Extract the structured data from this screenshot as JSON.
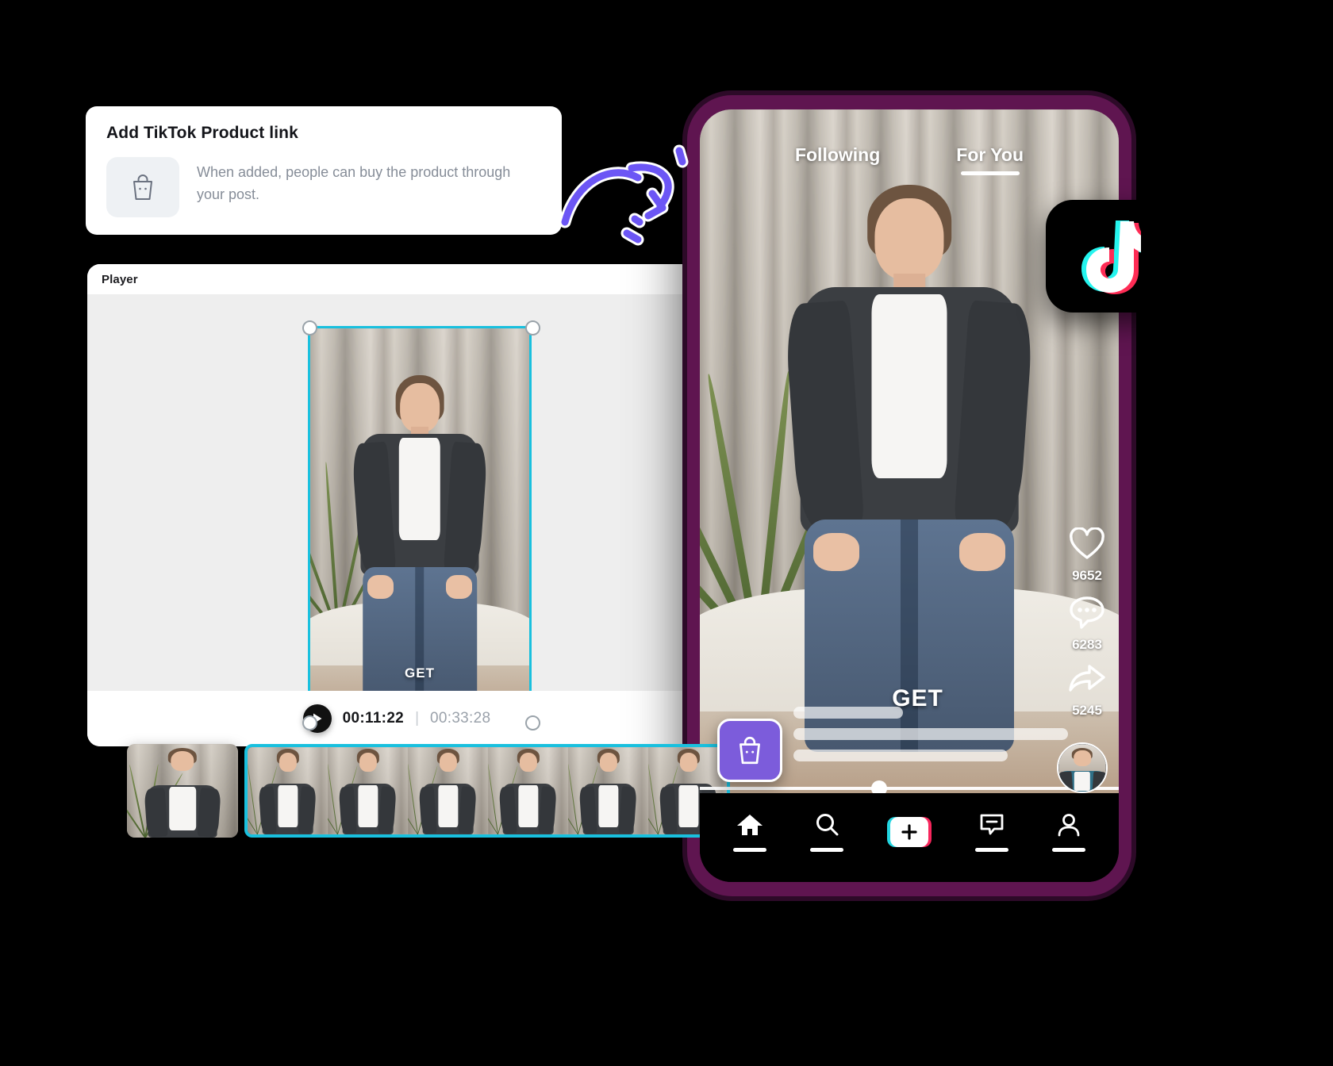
{
  "card": {
    "title": "Add TikTok Product link",
    "description": "When added, people can buy the product through your post.",
    "icon": "shopping-bag-icon"
  },
  "editor": {
    "title": "Player",
    "controls": {
      "play_icon": "play-icon",
      "current_time": "00:11:22",
      "separator": "|",
      "total_time": "00:33:28"
    },
    "selection_color": "#19c0de",
    "canvas_bg": "#eeeeee",
    "overlay_text": "GET"
  },
  "timeline": {
    "clip_count": 6,
    "selected_border_color": "#19c0de"
  },
  "phone": {
    "frame_color": "#5f1550",
    "tabs": [
      {
        "label": "Following",
        "active": false
      },
      {
        "label": "For You",
        "active": true
      }
    ],
    "rail": [
      {
        "icon": "heart-icon",
        "count": "9652"
      },
      {
        "icon": "comment-icon",
        "count": "6283"
      },
      {
        "icon": "share-icon",
        "count": "5245"
      }
    ],
    "shop_button": {
      "icon": "shopping-bag-icon",
      "color": "#7c5cdb"
    },
    "avatar": "avatar",
    "overlay_text": "GET",
    "nav": [
      {
        "icon": "home-icon",
        "label": "home"
      },
      {
        "icon": "search-icon",
        "label": "search"
      },
      {
        "icon": "plus-icon",
        "label": "create"
      },
      {
        "icon": "inbox-icon",
        "label": "inbox"
      },
      {
        "icon": "profile-icon",
        "label": "profile"
      }
    ]
  },
  "decor": {
    "arrow": "curved-arrow-icon",
    "tiktok_logo": "tiktok-logo-icon",
    "accent_purple": "#6c56f5"
  }
}
